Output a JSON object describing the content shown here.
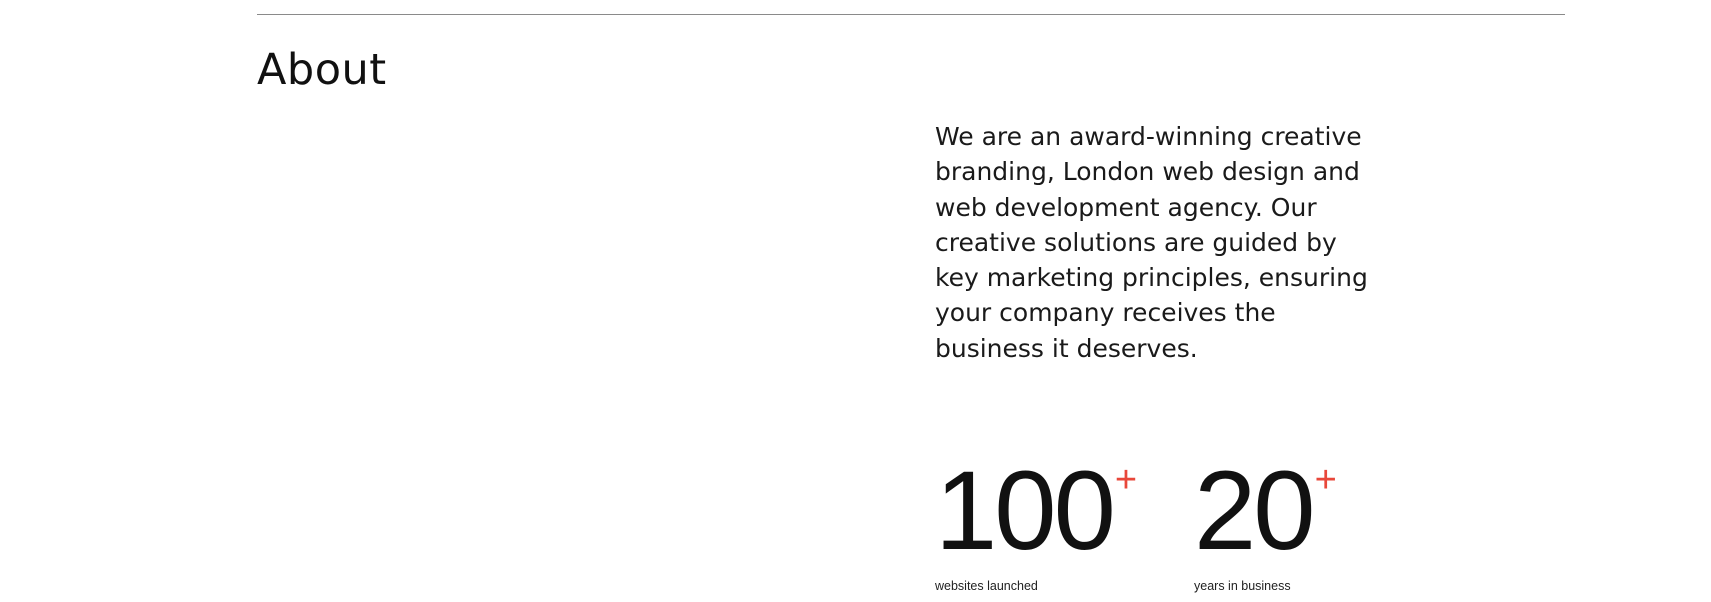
{
  "about": {
    "title": "About",
    "intro": "We are an award-winning creative branding, London web design and web development agency. Our creative solutions are guided by key marketing principles, ensuring your company receives the business it deserves."
  },
  "stats": [
    {
      "value": "100",
      "suffix": "+",
      "label": "websites launched"
    },
    {
      "value": "20",
      "suffix": "+",
      "label": "years in business"
    }
  ],
  "colors": {
    "accent": "#e8473a",
    "text": "#111111",
    "divider": "#8a8a8a",
    "background": "#ffffff"
  }
}
